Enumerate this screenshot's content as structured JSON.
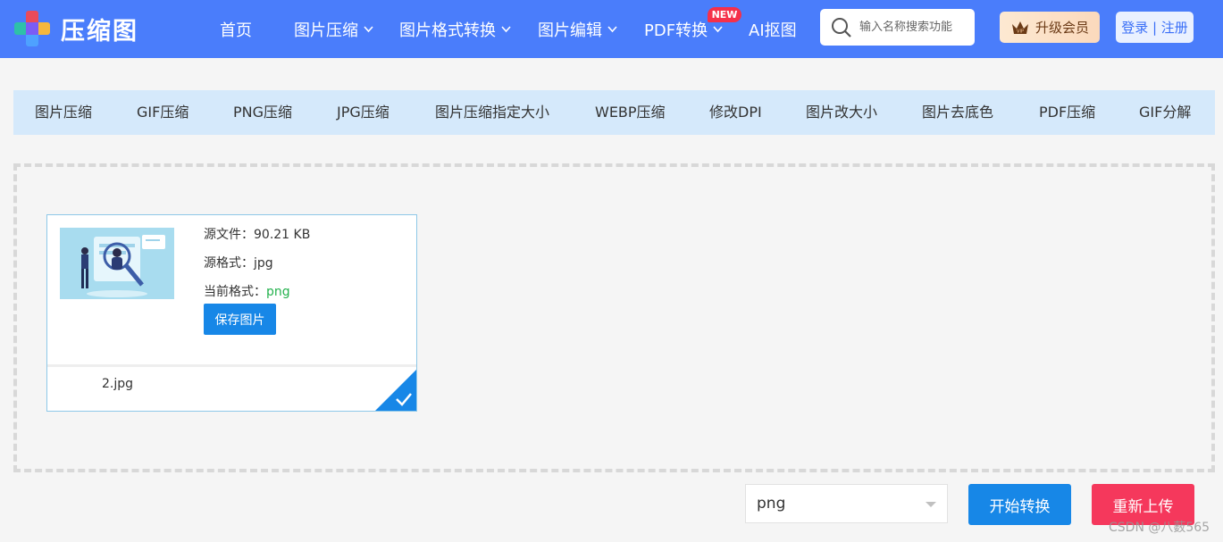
{
  "header": {
    "logo_text": "压缩图",
    "nav": [
      {
        "label": "首页",
        "has_dropdown": false
      },
      {
        "label": "图片压缩",
        "has_dropdown": true
      },
      {
        "label": "图片格式转换",
        "has_dropdown": true
      },
      {
        "label": "图片编辑",
        "has_dropdown": true
      },
      {
        "label": "PDF转换",
        "has_dropdown": true,
        "badge": "NEW"
      },
      {
        "label": "AI抠图",
        "has_dropdown": false
      }
    ],
    "search_placeholder": "输入名称搜索功能",
    "vip_label": "升级会员",
    "vip_icon": "crown-vip-icon",
    "login_label": "登录 | 注册"
  },
  "tabs": [
    "图片压缩",
    "GIF压缩",
    "PNG压缩",
    "JPG压缩",
    "图片压缩指定大小",
    "WEBP压缩",
    "修改DPI",
    "图片改大小",
    "图片去底色",
    "PDF压缩",
    "GIF分解"
  ],
  "file_card": {
    "source_file_label": "源文件：",
    "source_file_size": "90.21 KB",
    "source_format_label": "源格式：",
    "source_format": "jpg",
    "current_format_label": "当前格式：",
    "current_format": "png",
    "save_label": "保存图片",
    "filename": "2.jpg",
    "status": "checked"
  },
  "controls": {
    "format_value": "png",
    "start_label": "开始转换",
    "reupload_label": "重新上传"
  },
  "watermark": "CSDN @八薮565",
  "colors": {
    "header_bg": "#4a7dfb",
    "tabbar_bg": "#d5e9fb",
    "primary": "#1787e7",
    "danger": "#f5385c",
    "success": "#23b14d"
  }
}
